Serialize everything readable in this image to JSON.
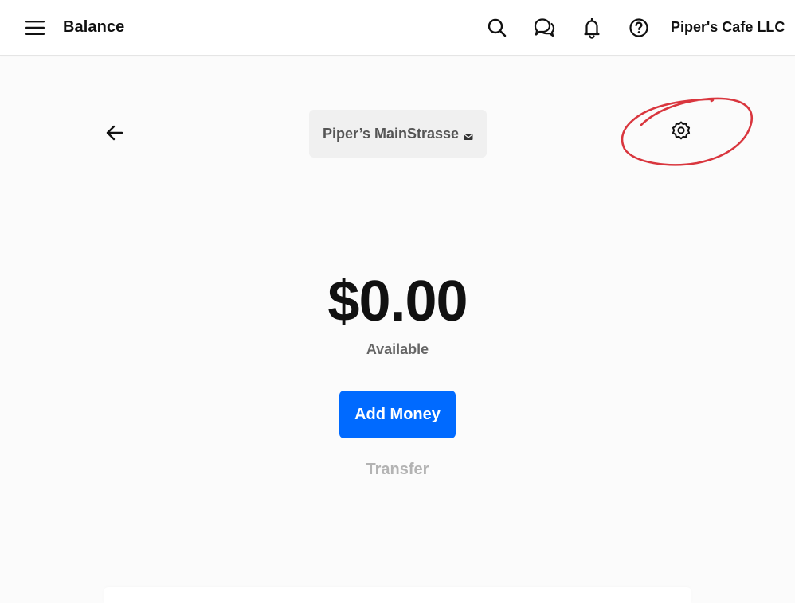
{
  "header": {
    "title": "Balance",
    "business_name": "Piper's Cafe LLC",
    "icons": [
      "menu-icon",
      "search-icon",
      "chat-icon",
      "bell-icon",
      "help-icon"
    ]
  },
  "account_selector": {
    "label": "Piper’s MainStrasse",
    "caret_icon": "caret-down-icon"
  },
  "navigation": {
    "back_icon": "arrow-left-icon",
    "settings_icon": "gear-icon"
  },
  "balance": {
    "amount": "$0.00",
    "label": "Available"
  },
  "actions": {
    "add_money_label": "Add Money",
    "transfer_label": "Transfer"
  },
  "colors": {
    "primary": "#006aff",
    "annotation": "#d9363e",
    "muted_text": "#666666",
    "disabled_text": "#b3b3b3"
  }
}
